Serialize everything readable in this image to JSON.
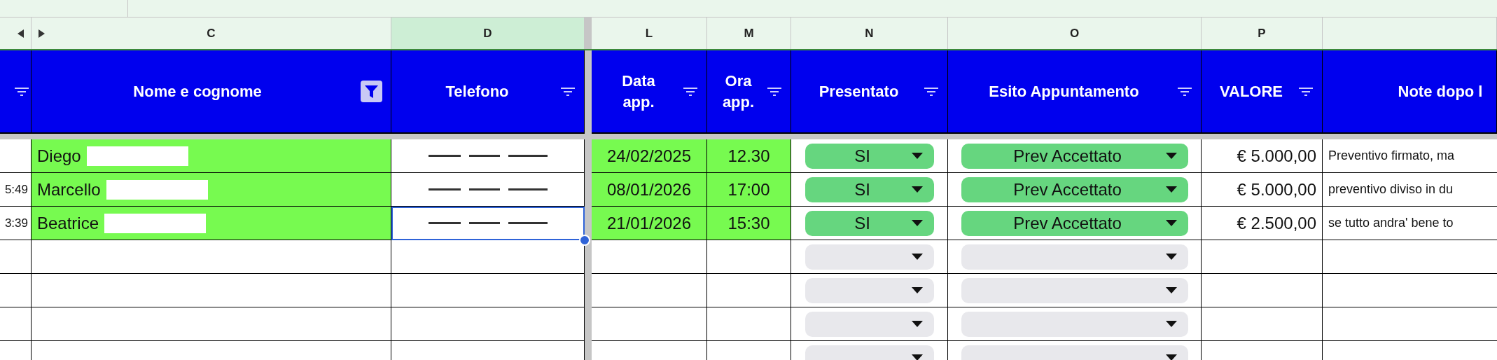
{
  "columns": [
    {
      "kind": "filter",
      "selected": false
    },
    {
      "letter": "C",
      "title": "Nome e cognome",
      "kind": "filtered",
      "selected": false
    },
    {
      "letter": "D",
      "title": "Telefono",
      "kind": "filter",
      "selected": true
    },
    {
      "letter": "L",
      "title": "Data app.",
      "kind": "filter",
      "selected": false
    },
    {
      "letter": "M",
      "title": "Ora app.",
      "kind": "filter",
      "selected": false
    },
    {
      "letter": "N",
      "title": "Presentato",
      "kind": "filter",
      "selected": false
    },
    {
      "letter": "O",
      "title": "Esito Appuntamento",
      "kind": "filter",
      "selected": false
    },
    {
      "letter": "P",
      "title": "VALORE",
      "kind": "filter",
      "selected": false
    },
    {
      "title": "Note dopo l",
      "kind": "plain",
      "selected": false
    }
  ],
  "rows": [
    {
      "filled": true,
      "name": "Diego",
      "name_redacted": true,
      "phone_redacted": true,
      "phone_selected": false,
      "date": "24/02/2025",
      "hour": "12.30",
      "presentato": "SI",
      "esito": "Prev Accettato",
      "valore": "€ 5.000,00",
      "note": "Preventivo firmato, ma"
    },
    {
      "filled": true,
      "time": "5:49",
      "name": "Marcello",
      "name_redacted": true,
      "phone_redacted": true,
      "phone_selected": false,
      "date": "08/01/2026",
      "hour": "17:00",
      "presentato": "SI",
      "esito": "Prev Accettato",
      "valore": "€ 5.000,00",
      "note": "preventivo diviso in du"
    },
    {
      "filled": true,
      "time": "3:39",
      "name": "Beatrice",
      "name_redacted": true,
      "phone_redacted": true,
      "phone_selected": true,
      "date": "21/01/2026",
      "hour": "15:30",
      "presentato": "SI",
      "esito": "Prev Accettato",
      "valore": "€ 2.500,00",
      "note": "se tutto andra' bene to"
    },
    {
      "filled": false,
      "phone_redacted": false,
      "phone_selected": false
    },
    {
      "filled": false,
      "phone_redacted": false,
      "phone_selected": false
    },
    {
      "filled": false,
      "phone_redacted": false,
      "phone_selected": false
    },
    {
      "filled": false,
      "phone_redacted": false,
      "phone_selected": false
    }
  ]
}
